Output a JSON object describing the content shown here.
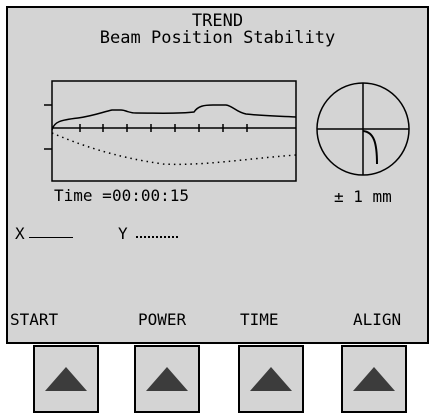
{
  "header": {
    "mode_label": "TREND",
    "title": "Beam Position Stability"
  },
  "trend": {
    "time_label": "Time =",
    "time_value": "00:00:15"
  },
  "target": {
    "scale_label": "± 1 mm"
  },
  "legend": {
    "x_label": "X",
    "y_label": "Y"
  },
  "softkeys": [
    {
      "label": "START"
    },
    {
      "label": "POWER"
    },
    {
      "label": "TIME"
    },
    {
      "label": "ALIGN"
    }
  ],
  "colors": {
    "screen_bg": "#d4d4d4",
    "foreground": "#000000",
    "button_arrow": "#3c3c3c"
  }
}
